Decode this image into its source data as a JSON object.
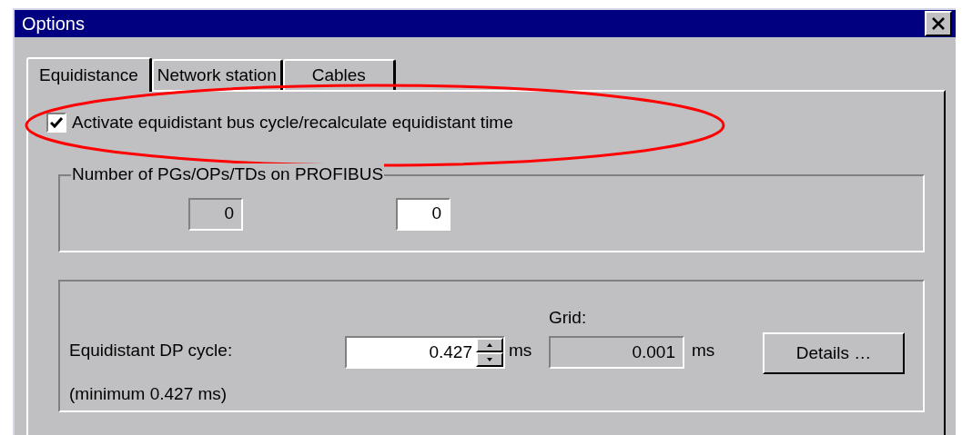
{
  "window": {
    "title": "Options"
  },
  "tabs": [
    {
      "label": "Equidistance",
      "selected": true
    },
    {
      "label": "Network station",
      "selected": false
    },
    {
      "label": "Cables",
      "selected": false
    }
  ],
  "activate_checkbox": {
    "label": "Activate equidistant bus cycle/recalculate equidistant time",
    "checked": true,
    "highlighted": true
  },
  "pg_group": {
    "title": "Number of PGs/OPs/TDs on PROFIBUS",
    "fields": [
      {
        "value": "0",
        "disabled": true
      },
      {
        "value": "0",
        "disabled": false
      }
    ]
  },
  "cycle_group": {
    "label": "Equidistant DP cycle:",
    "value": "0.427",
    "unit": "ms",
    "minimum_note": "(minimum 0.427 ms)",
    "grid_label": "Grid:",
    "grid_value": "0.001",
    "grid_unit": "ms",
    "details_button": "Details …"
  }
}
